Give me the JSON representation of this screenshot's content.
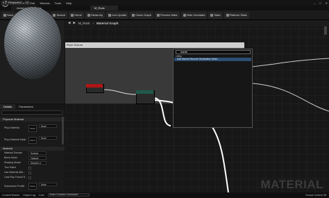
{
  "window": {
    "menu": [
      "File",
      "Edit",
      "Window",
      "Tools",
      "Help"
    ],
    "project_tab": "AshsLandscapeMap",
    "asset_tab": "M_Rock",
    "controls": [
      "–",
      "□",
      "✕"
    ]
  },
  "toolbar": {
    "buttons": [
      "Save",
      "Browse",
      "Apply",
      "Search",
      "Home",
      "Hierarchy",
      "Live Update",
      "Clean Graph",
      "Preview State",
      "Hide Unrelated",
      "Stats",
      "Platform Stats"
    ]
  },
  "viewport": {
    "buttons": [
      "Perspective",
      "Lit"
    ]
  },
  "details": {
    "tabs": [
      "Details",
      "Parameters"
    ],
    "sections": {
      "physical": "Physical Material",
      "material": "Material"
    },
    "physical_props": [
      {
        "label": "Phys Material",
        "value": "None"
      },
      {
        "label": "Phys Material Mask",
        "value": "None"
      }
    ],
    "thumb_label": "None",
    "material_props": [
      {
        "label": "Material Domain",
        "value": "Surface"
      },
      {
        "label": "Blend Mode",
        "value": "Opaque"
      },
      {
        "label": "Shading Model",
        "value": "Default Lit"
      },
      {
        "label": "Two Sided",
        "value": ""
      },
      {
        "label": "Use Material Attri...",
        "value": ""
      },
      {
        "label": "Cast Ray Traced S...",
        "value": ""
      },
      {
        "label": "Subsurface Profile",
        "value": "None"
      }
    ]
  },
  "graph": {
    "breadcrumb": "M_Rock",
    "title": "Material Graph",
    "comment_title": "Rock Texture",
    "watermark": "MATERIAL",
    "search": {
      "query": "name",
      "category": "Utility",
      "result": "Add Named Reroute Declaration Node..."
    }
  },
  "statusbar": {
    "left": [
      "Content Drawer",
      "Output Log",
      "Cmd"
    ],
    "cmd_placeholder": "Enter Console Command",
    "right": [
      "Source Control Off"
    ]
  }
}
